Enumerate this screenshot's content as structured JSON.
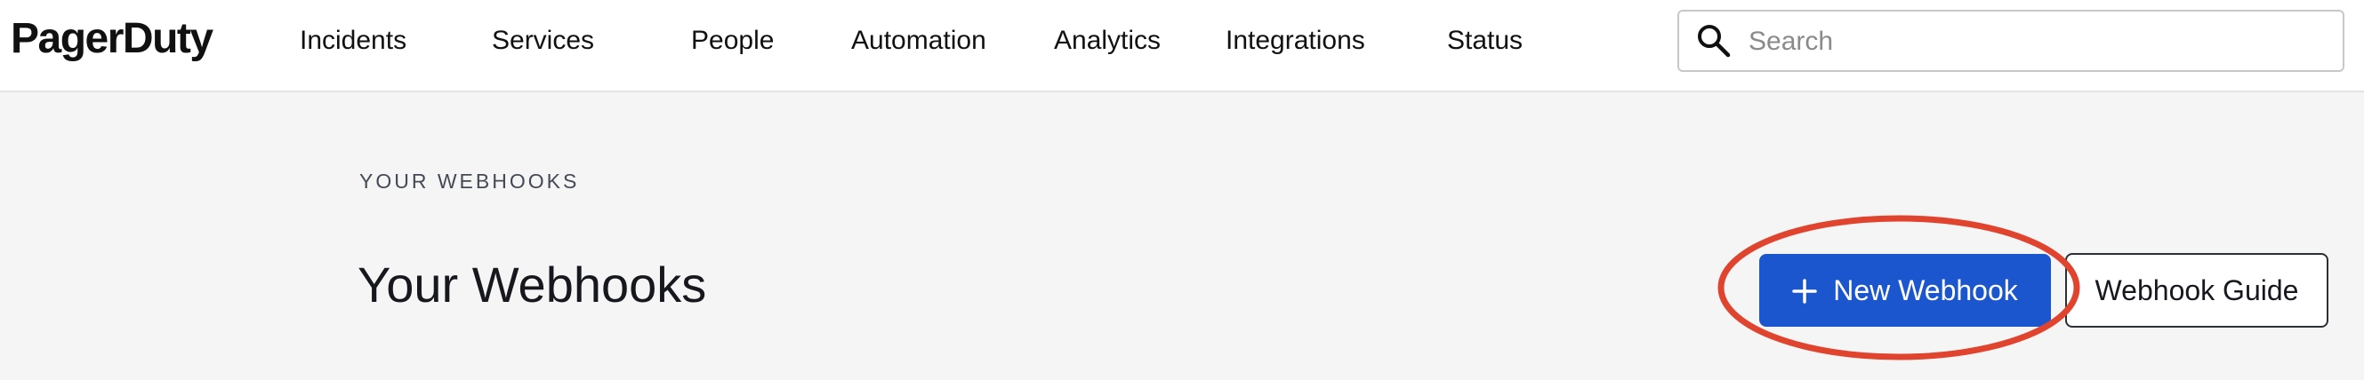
{
  "app": {
    "logo_text": "PagerDuty"
  },
  "nav": {
    "items": [
      {
        "label": "Incidents"
      },
      {
        "label": "Services"
      },
      {
        "label": "People"
      },
      {
        "label": "Automation"
      },
      {
        "label": "Analytics"
      },
      {
        "label": "Integrations"
      },
      {
        "label": "Status"
      }
    ]
  },
  "search": {
    "placeholder": "Search",
    "value": "",
    "icon": "search-icon"
  },
  "page": {
    "eyebrow": "YOUR WEBHOOKS",
    "title": "Your Webhooks"
  },
  "actions": {
    "new_webhook_label": "New Webhook",
    "new_webhook_icon": "plus-icon",
    "webhook_guide_label": "Webhook Guide"
  },
  "colors": {
    "primary_button": "#1b56cf",
    "highlight_annotation": "#e0442e",
    "page_background": "#f5f5f5",
    "topbar_background": "#ffffff"
  }
}
